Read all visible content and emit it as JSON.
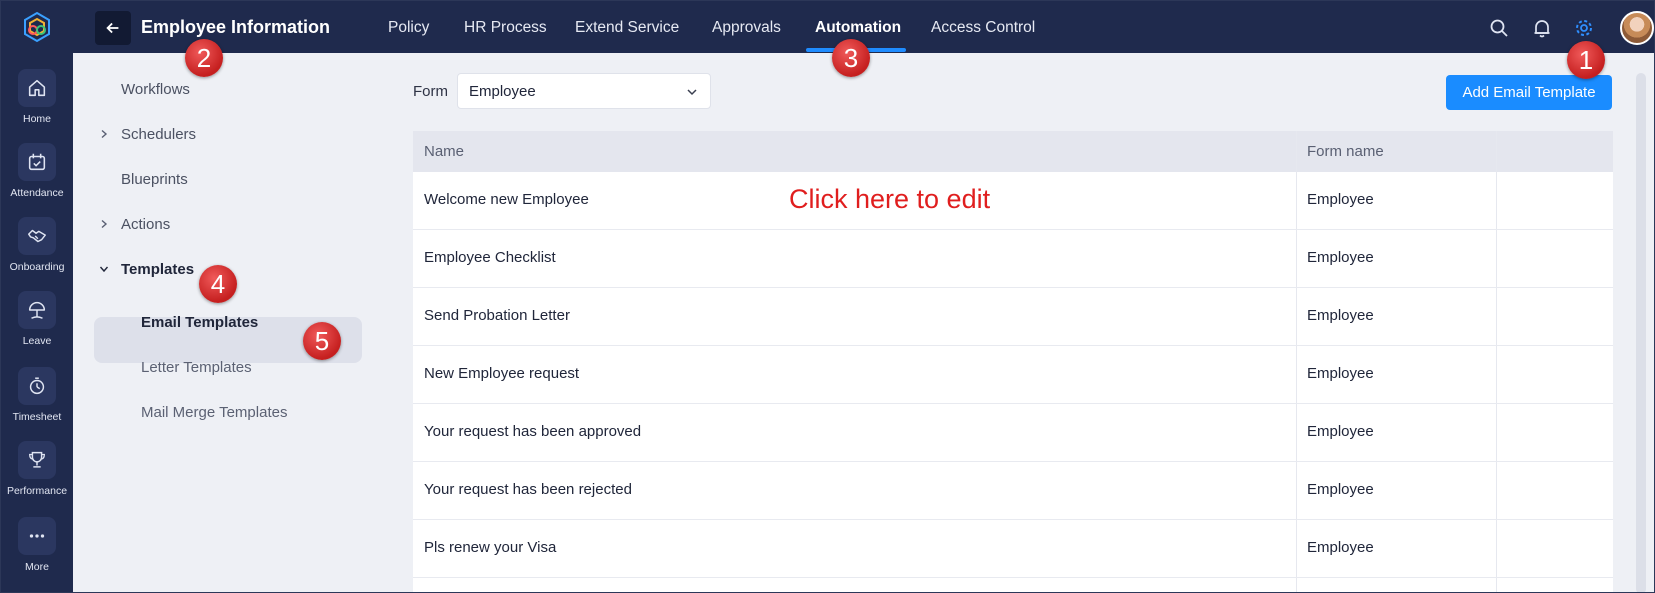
{
  "rail": {
    "items": [
      {
        "label": "Home",
        "icon": "home-icon"
      },
      {
        "label": "Attendance",
        "icon": "calendar-check-icon"
      },
      {
        "label": "Onboarding",
        "icon": "handshake-icon"
      },
      {
        "label": "Leave",
        "icon": "beach-umbrella-icon"
      },
      {
        "label": "Timesheet",
        "icon": "stopwatch-icon"
      },
      {
        "label": "Performance",
        "icon": "trophy-icon"
      },
      {
        "label": "More",
        "icon": "more-dots-icon"
      }
    ]
  },
  "header": {
    "title": "Employee Information",
    "tabs": [
      {
        "label": "Policy"
      },
      {
        "label": "HR Process"
      },
      {
        "label": "Extend Service"
      },
      {
        "label": "Approvals"
      },
      {
        "label": "Automation",
        "active": true
      },
      {
        "label": "Access Control"
      }
    ]
  },
  "sidebar": {
    "items": [
      {
        "label": "Workflows"
      },
      {
        "label": "Schedulers"
      },
      {
        "label": "Blueprints"
      },
      {
        "label": "Actions"
      },
      {
        "label": "Templates"
      }
    ],
    "sub_items": [
      {
        "label": "Email Templates",
        "active": true
      },
      {
        "label": "Letter Templates"
      },
      {
        "label": "Mail Merge Templates"
      }
    ]
  },
  "main": {
    "form_label": "Form",
    "form_value": "Employee",
    "add_button": "Add Email Template",
    "columns": [
      "Name",
      "Form name"
    ],
    "rows": [
      {
        "name": "Welcome new Employee",
        "form": "Employee"
      },
      {
        "name": "Employee Checklist",
        "form": "Employee"
      },
      {
        "name": "Send Probation Letter",
        "form": "Employee"
      },
      {
        "name": "New Employee request",
        "form": "Employee"
      },
      {
        "name": "Your request has been approved",
        "form": "Employee"
      },
      {
        "name": "Your request has been rejected",
        "form": "Employee"
      },
      {
        "name": "Pls renew your Visa",
        "form": "Employee"
      }
    ],
    "edit_hint": "Click here to edit"
  },
  "markers": [
    "1",
    "2",
    "3",
    "4",
    "5"
  ],
  "colors": {
    "nav_bg": "#1f2a4d",
    "accent": "#1a8cff",
    "marker": "#d32f2f",
    "hint": "#e01e1e"
  }
}
